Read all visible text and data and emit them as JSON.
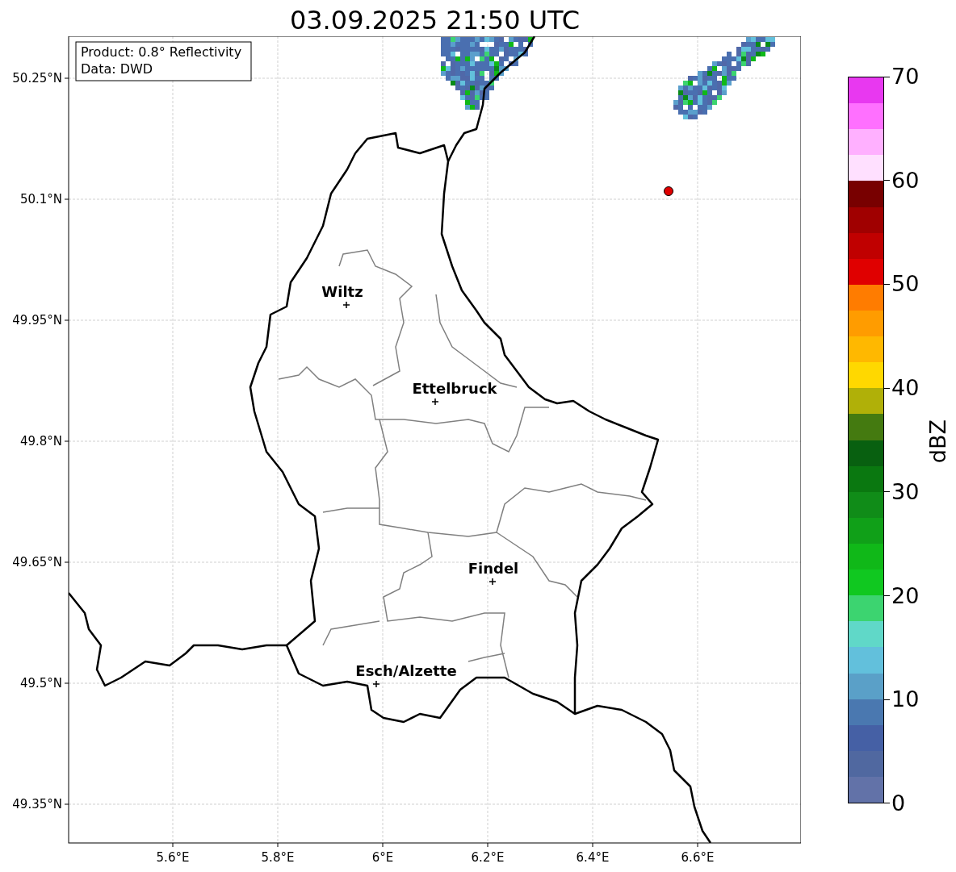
{
  "title": "03.09.2025 21:50 UTC",
  "info_box": [
    "Product: 0.8° Reflectivity",
    "Data: DWD"
  ],
  "map": {
    "y_ticks": [
      "50.25°N",
      "50.1°N",
      "49.95°N",
      "49.8°N",
      "49.65°N",
      "49.5°N",
      "49.35°N"
    ],
    "x_ticks": [
      "5.6°E",
      "5.8°E",
      "6°E",
      "6.2°E",
      "6.4°E",
      "6.6°E"
    ],
    "cities": [
      {
        "name": "Wiltz"
      },
      {
        "name": "Ettelbruck"
      },
      {
        "name": "Findel"
      },
      {
        "name": "Esch/Alzette"
      }
    ]
  },
  "colorbar": {
    "label": "dBZ",
    "ticks": [
      "70",
      "60",
      "50",
      "40",
      "30",
      "20",
      "10",
      "0"
    ],
    "segments": [
      {
        "color": "#e838f0"
      },
      {
        "color": "#ff70ff"
      },
      {
        "color": "#ffb0ff"
      },
      {
        "color": "#ffe0ff"
      },
      {
        "color": "#780000"
      },
      {
        "color": "#a00000"
      },
      {
        "color": "#c00000"
      },
      {
        "color": "#e00000"
      },
      {
        "color": "#ff7c00"
      },
      {
        "color": "#ff9c00"
      },
      {
        "color": "#ffb800"
      },
      {
        "color": "#ffd800"
      },
      {
        "color": "#b0b008"
      },
      {
        "color": "#447a10"
      },
      {
        "color": "#086010"
      },
      {
        "color": "#0a7810"
      },
      {
        "color": "#108c18"
      },
      {
        "color": "#10a018"
      },
      {
        "color": "#10b818"
      },
      {
        "color": "#10c820"
      },
      {
        "color": "#3cd470"
      },
      {
        "color": "#60d8c8"
      },
      {
        "color": "#62c0dc"
      },
      {
        "color": "#5aa0c8"
      },
      {
        "color": "#4a78b0"
      },
      {
        "color": "#4560a5"
      },
      {
        "color": "#5068a0"
      },
      {
        "color": "#6272a8"
      }
    ]
  }
}
